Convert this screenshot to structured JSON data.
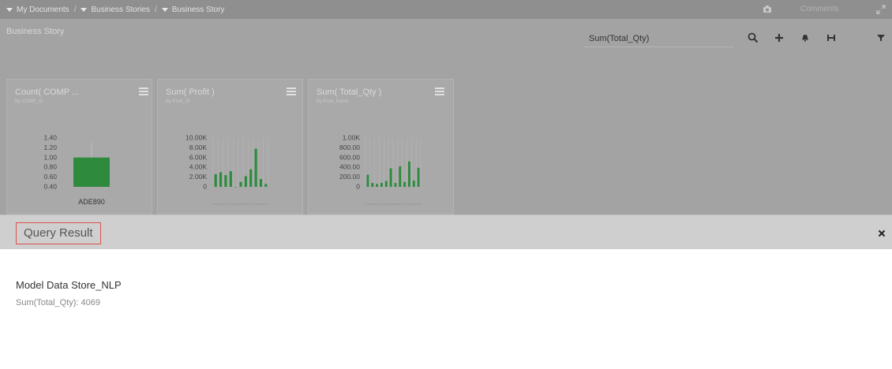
{
  "breadcrumb": {
    "items": [
      "My Documents",
      "Business Stories",
      "Business Story"
    ],
    "separators": [
      "/",
      "/"
    ]
  },
  "topbar": {
    "comments_label": "Comments",
    "icons": [
      "camera-icon",
      "expand-icon"
    ]
  },
  "story": {
    "title": "Business Story"
  },
  "search": {
    "value": "Sum(Total_Qty)"
  },
  "toolbar": {
    "icons": [
      "search-icon",
      "plus-icon",
      "bell-icon",
      "save-icon",
      "filter-icon"
    ]
  },
  "widgets": [
    {
      "title": "Count( COMP ...",
      "subtitle": "By COMP_ID",
      "chart_data": {
        "type": "bar",
        "categories": [
          "ADE890"
        ],
        "values": [
          1.0
        ],
        "ylim": [
          0.4,
          1.4
        ],
        "yticks": [
          "1.40",
          "1.20",
          "1.00",
          "0.80",
          "0.60",
          "0.40"
        ],
        "xlabel_visible": "ADE890",
        "color": "#2e8b3e"
      }
    },
    {
      "title": "Sum( Profit )",
      "subtitle": "By Prod_ID",
      "chart_data": {
        "type": "bar",
        "values": [
          2600,
          3000,
          2400,
          3200,
          0,
          1000,
          2200,
          3600,
          7800,
          1600,
          600
        ],
        "ylim": [
          0,
          10000
        ],
        "yticks": [
          "10.00K",
          "8.00K",
          "6.00K",
          "4.00K",
          "2.00K",
          "0"
        ],
        "color": "#2e8b3e"
      }
    },
    {
      "title": "Sum( Total_Qty )",
      "subtitle": "By Prod_Name",
      "chart_data": {
        "type": "bar",
        "values": [
          250,
          80,
          60,
          80,
          120,
          380,
          80,
          420,
          100,
          520,
          130,
          390
        ],
        "ylim": [
          0,
          1000
        ],
        "yticks": [
          "1.00K",
          "800.00",
          "600.00",
          "400.00",
          "200.00",
          "0"
        ],
        "color": "#2e8b3e"
      }
    }
  ],
  "query_result": {
    "title": "Query Result",
    "store_name": "Model Data Store_NLP",
    "result_text": "Sum(Total_Qty): 4069"
  },
  "colors": {
    "accent_green": "#2e8b3e",
    "highlight_border": "#d9534f"
  }
}
